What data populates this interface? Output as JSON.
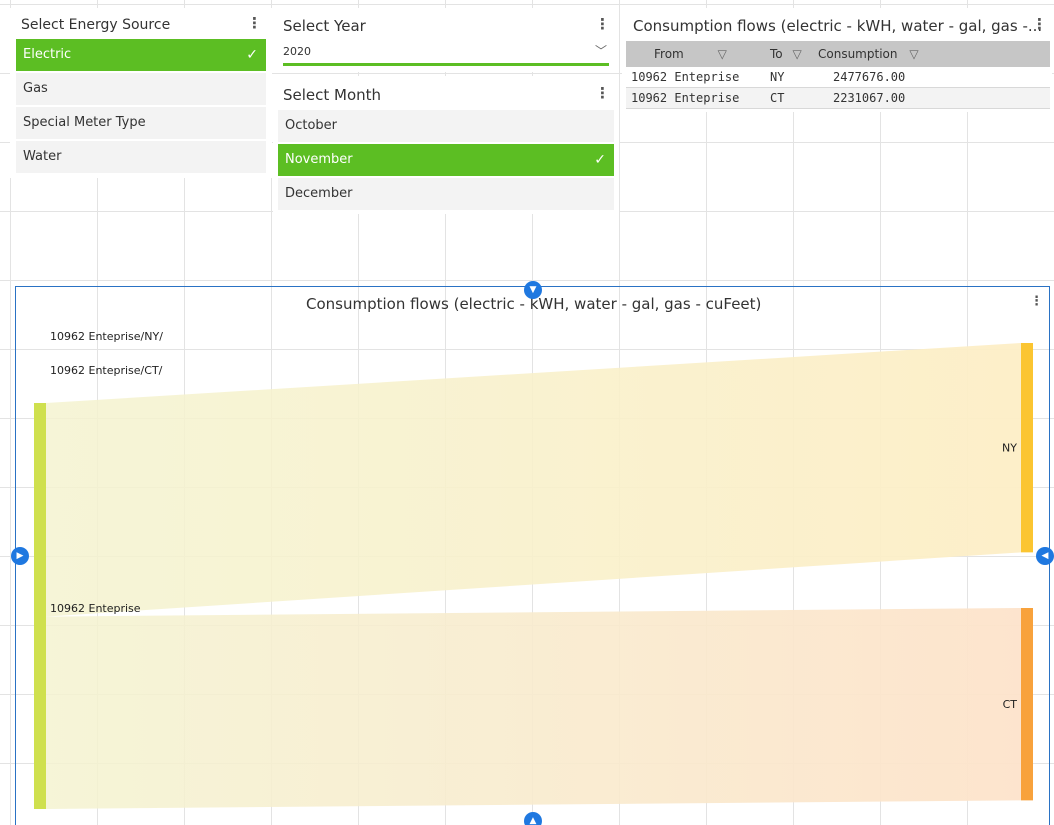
{
  "energy_source": {
    "title": "Select Energy Source",
    "items": [
      {
        "label": "Electric",
        "selected": true
      },
      {
        "label": "Gas",
        "selected": false
      },
      {
        "label": "Special Meter Type",
        "selected": false
      },
      {
        "label": "Water",
        "selected": false
      }
    ],
    "check_glyph": "✓"
  },
  "year": {
    "title": "Select Year",
    "value": "2020",
    "chevron": "﹀"
  },
  "month": {
    "title": "Select Month",
    "items": [
      {
        "label": "October",
        "selected": false
      },
      {
        "label": "November",
        "selected": true
      },
      {
        "label": "December",
        "selected": false
      }
    ]
  },
  "table_panel": {
    "title": "Consumption flows (electric - kWH, water - gal, gas -...",
    "columns": [
      "From",
      "To",
      "Consumption"
    ],
    "rows": [
      [
        "10962 Enteprise",
        "NY",
        "2477676.00"
      ],
      [
        "10962 Enteprise",
        "CT",
        "2231067.00"
      ]
    ]
  },
  "sankey_panel": {
    "title": "Consumption flows (electric - kWH, water - gal, gas - cuFeet)"
  },
  "icons": {
    "kebab": "⋮",
    "funnel": "▽"
  },
  "colors": {
    "accent_green": "#5cbe23",
    "source_node": "#cfe04e",
    "ny_node": "#fbc531",
    "ct_node": "#f8a23c",
    "handle_blue": "#1f78e0"
  },
  "chart_data": {
    "type": "sankey",
    "title": "Consumption flows (electric - kWH, water - gal, gas - cuFeet)",
    "nodes": [
      {
        "name": "10962 Enteprise",
        "side": "source"
      },
      {
        "name": "NY",
        "side": "target"
      },
      {
        "name": "CT",
        "side": "target"
      }
    ],
    "links": [
      {
        "source": "10962 Enteprise",
        "target": "NY",
        "value": 2477676.0,
        "label": "10962 Enteprise/NY/"
      },
      {
        "source": "10962 Enteprise",
        "target": "CT",
        "value": 2231067.0,
        "label": "10962 Enteprise/CT/"
      }
    ]
  }
}
